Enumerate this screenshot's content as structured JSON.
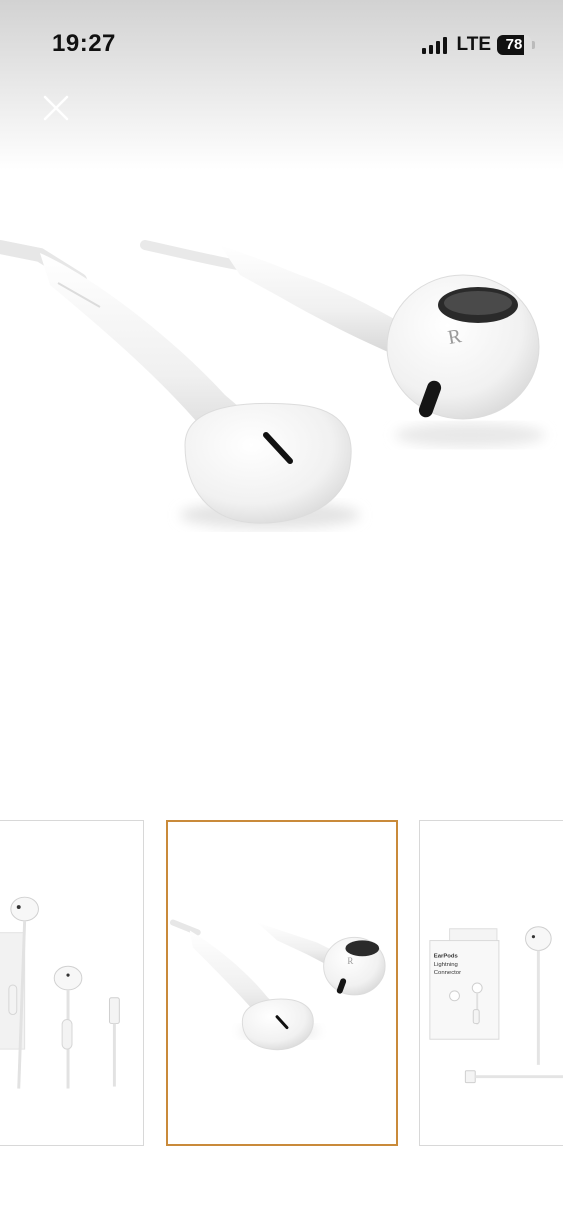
{
  "status_bar": {
    "time": "19:27",
    "network": "LTE",
    "battery": "78",
    "battery_level": 0.78,
    "signal_bars": 4
  },
  "toolbar": {
    "close_icon": "close-icon"
  },
  "product": {
    "main_image": "earpods-closeup",
    "thumbnails": [
      {
        "image": "earpods-with-lightning-connector",
        "selected": false
      },
      {
        "image": "earpods-closeup",
        "selected": true
      },
      {
        "image": "earpods-box-and-cable",
        "selected": false
      }
    ],
    "box": {
      "title": "EarPods",
      "subtitle_line1": "Lightning",
      "subtitle_line2": "Connector"
    }
  },
  "colors": {
    "selected_border": "#c98a3a",
    "thumb_border": "#d8d8d8"
  }
}
